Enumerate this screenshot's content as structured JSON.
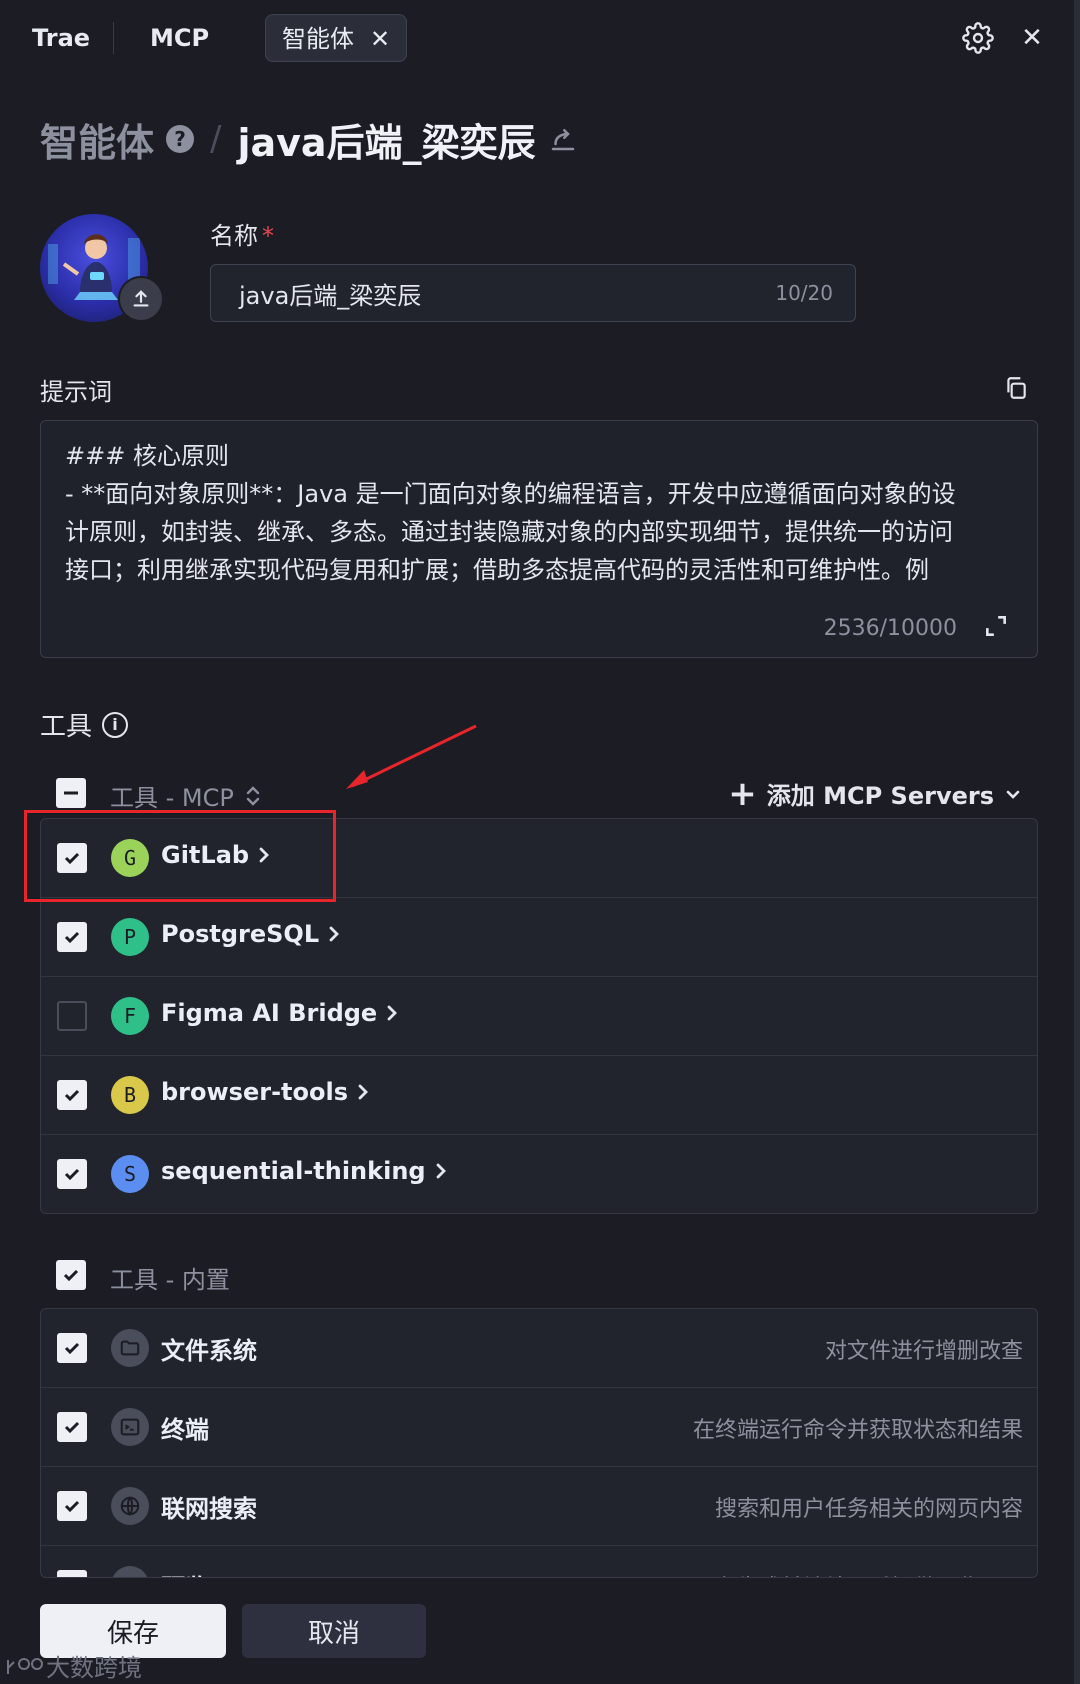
{
  "tabs": [
    {
      "label": "Trae"
    },
    {
      "label": "MCP"
    },
    {
      "label": "智能体",
      "active": true
    }
  ],
  "breadcrumb": {
    "root": "智能体",
    "current": "java后端_梁奕辰"
  },
  "name_field": {
    "label": "名称",
    "required_mark": "*",
    "value": "java后端_梁奕辰",
    "counter": "10/20"
  },
  "prompt": {
    "label": "提示词",
    "lines": [
      "### 核心原则",
      "- **面向对象原则**：Java 是一门面向对象的编程语言，开发中应遵循面向对象的设",
      "计原则，如封装、继承、多态。通过封装隐藏对象的内部实现细节，提供统一的访问",
      "接口；利用继承实现代码复用和扩展；借助多态提高代码的灵活性和可维护性。例"
    ],
    "counter": "2536/10000"
  },
  "tools": {
    "title": "工具",
    "mcp_group": {
      "title": "工具 - MCP",
      "add_label": "添加 MCP Servers",
      "items": [
        {
          "letter": "G",
          "name": "GitLab",
          "checked": true,
          "color": "#9bd35a"
        },
        {
          "letter": "P",
          "name": "PostgreSQL",
          "checked": true,
          "color": "#2fc08a"
        },
        {
          "letter": "F",
          "name": "Figma AI Bridge",
          "checked": false,
          "color": "#2fc08a"
        },
        {
          "letter": "B",
          "name": "browser-tools",
          "checked": true,
          "color": "#d9c84a"
        },
        {
          "letter": "S",
          "name": "sequential-thinking",
          "checked": true,
          "color": "#5b8ef0"
        }
      ]
    },
    "builtin_group": {
      "title": "工具 - 内置",
      "items": [
        {
          "name": "文件系统",
          "desc": "对文件进行增删改查",
          "icon": "folder-icon",
          "checked": true
        },
        {
          "name": "终端",
          "desc": "在终端运行命令并获取状态和结果",
          "icon": "terminal-icon",
          "checked": true
        },
        {
          "name": "联网搜索",
          "desc": "搜索和用户任务相关的网页内容",
          "icon": "globe-icon",
          "checked": true
        },
        {
          "name": "预览",
          "desc": "在生成前端结果后提供预览入口",
          "icon": "preview-icon",
          "checked": true
        }
      ]
    }
  },
  "footer": {
    "save": "保存",
    "cancel": "取消"
  },
  "watermark": "大数跨境",
  "colors": {
    "background": "#1c1d24",
    "panel": "#22242d",
    "highlight": "#e8252a"
  }
}
